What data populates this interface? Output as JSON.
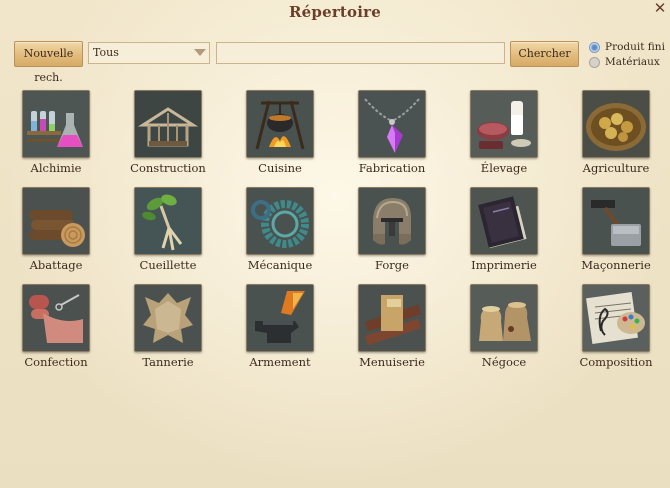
{
  "window": {
    "title": "Répertoire",
    "close_icon": "close-icon"
  },
  "toolbar": {
    "new_search_label": "Nouvelle rech.",
    "filter_select_value": "Tous",
    "search_input_value": "",
    "search_button_label": "Chercher"
  },
  "radios": {
    "options": [
      {
        "label": "Produit fini",
        "selected": true
      },
      {
        "label": "Matériaux",
        "selected": false
      }
    ]
  },
  "categories": [
    {
      "label": "Alchimie",
      "icon": "alchemy-icon"
    },
    {
      "label": "Construction",
      "icon": "construction-icon"
    },
    {
      "label": "Cuisine",
      "icon": "cooking-icon"
    },
    {
      "label": "Fabrication",
      "icon": "crafting-icon"
    },
    {
      "label": "Élevage",
      "icon": "livestock-icon"
    },
    {
      "label": "Agriculture",
      "icon": "agriculture-icon"
    },
    {
      "label": "Abattage",
      "icon": "logging-icon"
    },
    {
      "label": "Cueillette",
      "icon": "gathering-icon"
    },
    {
      "label": "Mécanique",
      "icon": "mechanics-icon"
    },
    {
      "label": "Forge",
      "icon": "forge-icon"
    },
    {
      "label": "Imprimerie",
      "icon": "printing-icon"
    },
    {
      "label": "Maçonnerie",
      "icon": "masonry-icon"
    },
    {
      "label": "Confection",
      "icon": "tailoring-icon"
    },
    {
      "label": "Tannerie",
      "icon": "tannery-icon"
    },
    {
      "label": "Armement",
      "icon": "weaponry-icon"
    },
    {
      "label": "Menuiserie",
      "icon": "carpentry-icon"
    },
    {
      "label": "Négoce",
      "icon": "trade-icon"
    },
    {
      "label": "Composition",
      "icon": "composition-icon"
    }
  ]
}
